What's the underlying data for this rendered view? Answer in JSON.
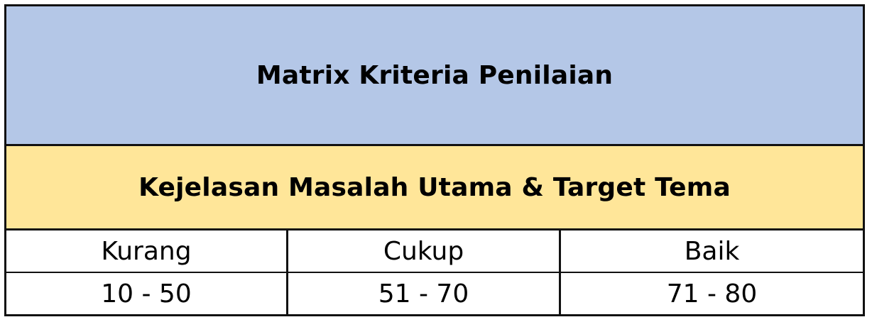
{
  "title": "Matrix Kriteria Penilaian",
  "subtitle": "Kejelasan Masalah Utama & Target Tema",
  "categories": [
    {
      "label": "Kurang",
      "range": "10 - 50"
    },
    {
      "label": "Cukup",
      "range": "51 - 70"
    },
    {
      "label": "Baik",
      "range": "71 - 80"
    }
  ],
  "colors": {
    "title_bg": "#b4c7e7",
    "subtitle_bg": "#ffe699",
    "border": "#111111"
  }
}
